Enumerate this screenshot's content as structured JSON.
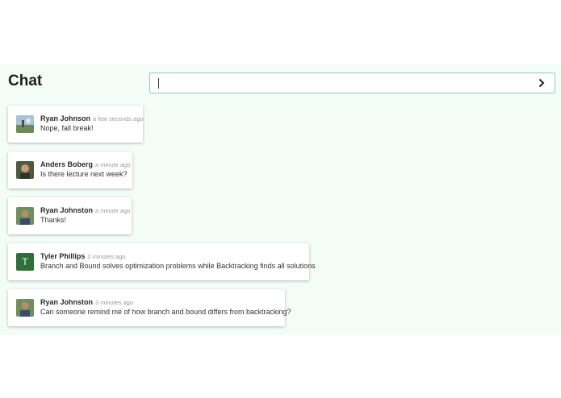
{
  "header": {
    "title": "Chat"
  },
  "composer": {
    "value": "",
    "placeholder": ""
  },
  "messages": [
    {
      "author": "Ryan Johnson",
      "time": "a few seconds ago",
      "text": "Nope, fall break!",
      "avatar": "photo-landscape"
    },
    {
      "author": "Anders Boberg",
      "time": "a minute ago",
      "text": "Is there lecture next week?",
      "avatar": "photo-person"
    },
    {
      "author": "Ryan Johnston",
      "time": "a minute ago",
      "text": "Thanks!",
      "avatar": "photo-person"
    },
    {
      "author": "Tyler Phillips",
      "time": "2 minutes ago",
      "text": "Branch and Bound solves optimization problems while Backtracking finds all solutions",
      "avatar": "T"
    },
    {
      "author": "Ryan Johnston",
      "time": "3 minutes ago",
      "text": "Can someone remind me of how branch and bound differs from backtracking?",
      "avatar": "photo-person"
    }
  ],
  "colors": {
    "panel_bg": "#f3fcf6",
    "input_border": "#9cc7c0",
    "letter_avatar_bg": "#2f6f3a"
  }
}
